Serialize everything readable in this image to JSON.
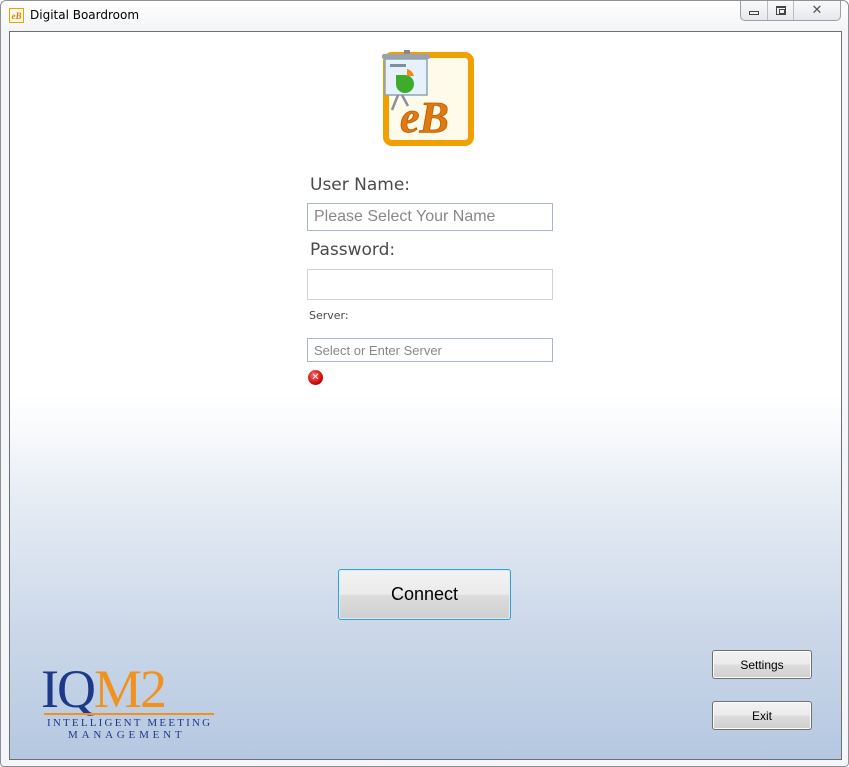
{
  "window": {
    "title": "Digital Boardroom",
    "app_icon": "eb-app-icon",
    "caption_buttons": {
      "minimize": "minimize-icon",
      "maximize": "maximize-icon",
      "close": "close-icon",
      "close_glyph": "✕"
    }
  },
  "logo": {
    "text": "eB",
    "icon": "presentation-board-icon",
    "colors": {
      "frame": "#f0a000",
      "letters": "#e07a10"
    }
  },
  "form": {
    "username_label": "User Name:",
    "username_placeholder": "Please Select Your Name",
    "username_value": "",
    "password_label": "Password:",
    "password_value": "",
    "server_label": "Server:",
    "server_placeholder": "Select or Enter Server",
    "server_value": "",
    "error_icon": "error-icon",
    "error_glyph": "✕"
  },
  "buttons": {
    "connect": "Connect",
    "settings": "Settings",
    "exit": "Exit"
  },
  "brand": {
    "logo_iq": "IQ",
    "logo_m2": "M2",
    "line1": "INTELLIGENT MEETING",
    "line2": "MANAGEMENT",
    "colors": {
      "primary": "#1d3a8a",
      "accent": "#f0931e"
    }
  }
}
